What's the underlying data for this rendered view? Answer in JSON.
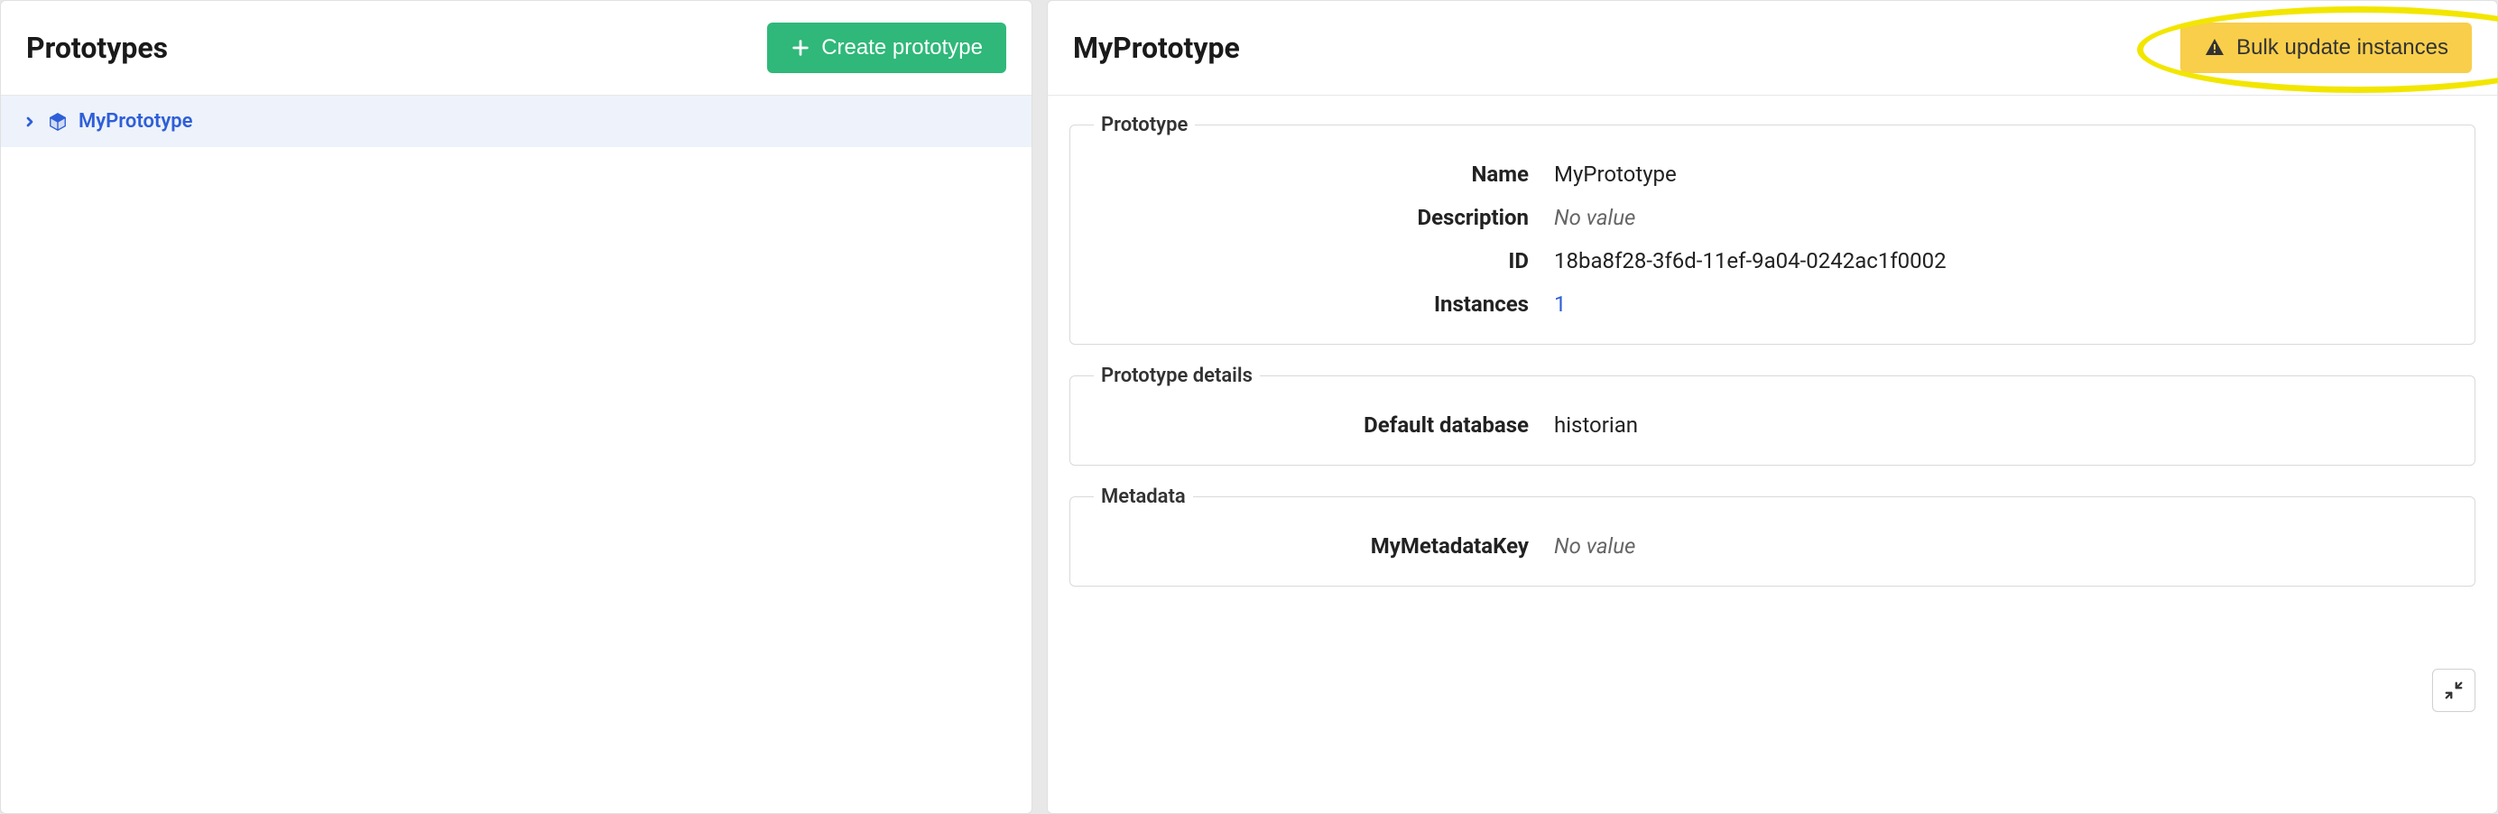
{
  "left": {
    "title": "Prototypes",
    "create_label": "Create prototype",
    "tree": {
      "item_label": "MyPrototype"
    }
  },
  "right": {
    "title": "MyPrototype",
    "bulk_label": "Bulk update instances",
    "sections": {
      "proto": {
        "legend": "Prototype",
        "name_label": "Name",
        "name_value": "MyPrototype",
        "desc_label": "Description",
        "desc_value": "No value",
        "id_label": "ID",
        "id_value": "18ba8f28-3f6d-11ef-9a04-0242ac1f0002",
        "instances_label": "Instances",
        "instances_value": "1"
      },
      "details": {
        "legend": "Prototype details",
        "db_label": "Default database",
        "db_value": "historian"
      },
      "metadata": {
        "legend": "Metadata",
        "key_label": "MyMetadataKey",
        "key_value": "No value"
      }
    }
  }
}
